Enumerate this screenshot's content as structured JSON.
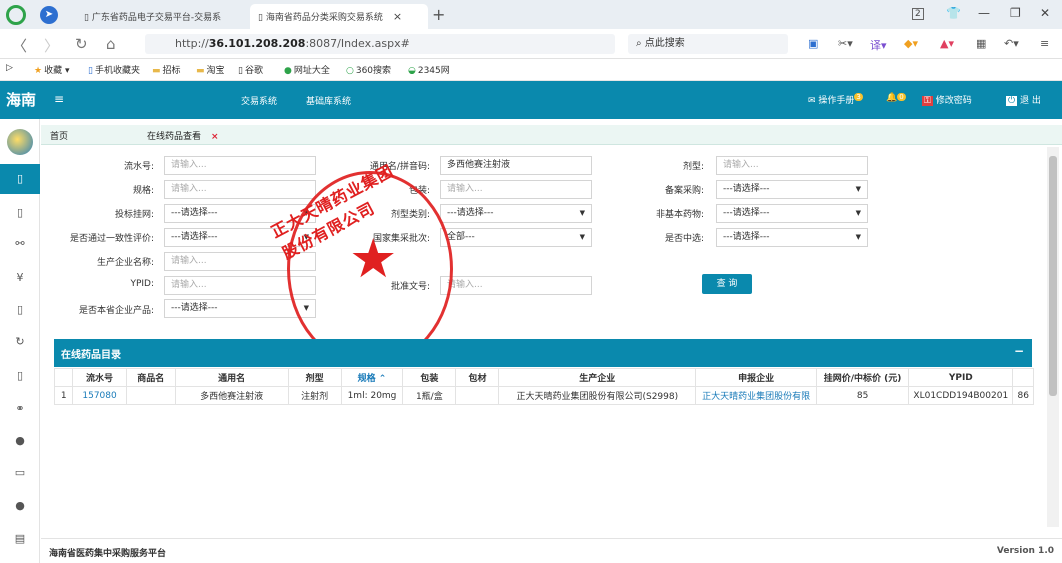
{
  "browser": {
    "tabs": [
      {
        "label": "广东省药品电子交易平台-交易系"
      },
      {
        "label": "海南省药品分类采购交易系统"
      }
    ],
    "tab_count": "2",
    "url_prefix": "http://",
    "url_host": "36.101.208.208",
    "url_rest": ":8087/Index.aspx#",
    "search_placeholder": "点此搜索",
    "bookmarks": [
      "收藏",
      "手机收藏夹",
      "招标",
      "淘宝",
      "谷歌",
      "网址大全",
      "360搜索",
      "2345网"
    ]
  },
  "app": {
    "logo": "海南",
    "nav": [
      "交易系统",
      "基础库系统"
    ],
    "manual": "操作手册",
    "manual_badge": "3",
    "notify_badge": "0",
    "change_password": "修改密码",
    "logout": "退 出",
    "breadcrumb_home": "首页",
    "active_tab": "在线药品查看"
  },
  "form": {
    "serial_label": "流水号:",
    "serial_placeholder": "请输入...",
    "spec_label": "规格:",
    "spec_placeholder": "请输入...",
    "bid_label": "投标挂网:",
    "bid_value": "---请选择---",
    "consistency_label": "是否通过一致性评价:",
    "consistency_value": "---请选择---",
    "manufacturer_label": "生产企业名称:",
    "manufacturer_placeholder": "请输入...",
    "ypid_label": "YPID:",
    "ypid_placeholder": "请输入...",
    "own_product_label": "是否本省企业产品:",
    "own_product_value": "---请选择---",
    "generic_label": "通用名/拼音码:",
    "generic_value": "多西他赛注射液",
    "package_label": "包装:",
    "package_placeholder": "请输入...",
    "category_label": "剂型类别:",
    "category_value": "---请选择---",
    "national_label": "国家集采批次:",
    "national_value": "全部---",
    "approval_label": "批准文号:",
    "approval_placeholder": "请输入...",
    "dosage_label": "剂型:",
    "dosage_placeholder": "请输入...",
    "record_label": "备案采购:",
    "record_value": "---请选择---",
    "nonbasic_label": "非基本药物:",
    "nonbasic_value": "---请选择---",
    "selected_label": "是否中选:",
    "selected_value": "---请选择---",
    "query_button": "查 询"
  },
  "stamp": {
    "text": "正大天晴药业集团股份有限公司"
  },
  "table": {
    "title": "在线药品目录",
    "headers": [
      "",
      "流水号",
      "商品名",
      "通用名",
      "剂型",
      "规格 ⌃",
      "包装",
      "包材",
      "生产企业",
      "申报企业",
      "挂网价/中标价 (元)",
      "YPID",
      ""
    ],
    "rows": [
      [
        "1",
        "157080",
        "",
        "多西他赛注射液",
        "注射剂",
        "1ml: 20mg",
        "1瓶/盒",
        "",
        "正大天晴药业集团股份有限公司(S2998)",
        "正大天晴药业集团股份有限",
        "85",
        "XL01CDD194B00201",
        "86"
      ]
    ]
  },
  "footer": {
    "platform": "海南省医药集中采购服务平台",
    "version": "Version 1.0"
  },
  "colors": {
    "primary": "#0a89ad",
    "stamp": "#e02020",
    "link": "#1a7bb9"
  }
}
